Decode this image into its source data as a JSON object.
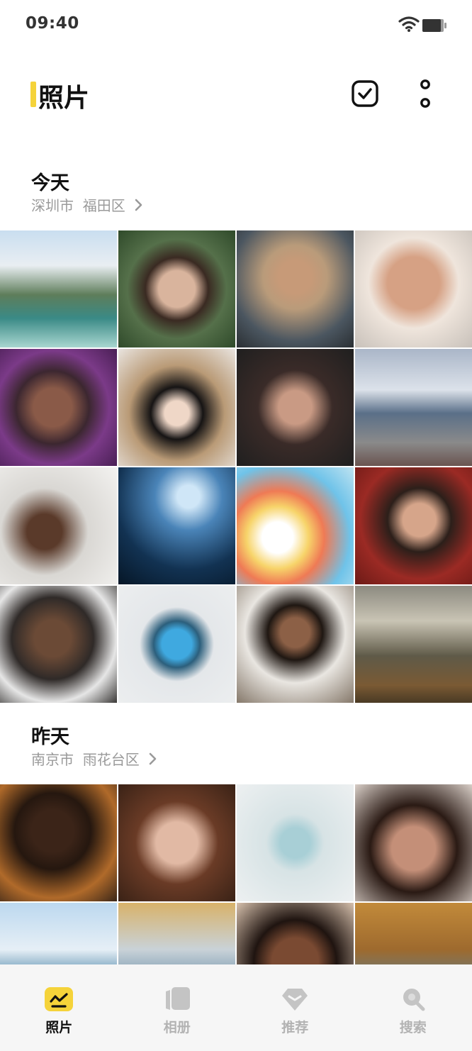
{
  "status_bar": {
    "time": "09:40"
  },
  "header": {
    "title": "照片"
  },
  "sections": [
    {
      "title": "今天",
      "location": "深圳市  福田区",
      "photos": [
        {
          "label": "mountain-lake",
          "bg": "linear-gradient(180deg,#c9def0 0%,#e9eef2 30%,#5e7d5a 55%,#3a8a86 75%,#a9d6d0 100%)"
        },
        {
          "label": "woman-flower",
          "bg": "radial-gradient(circle at 50% 50%,#d9b49d 0 22%,#3a2a22 38%,#55704a 60%,#2f4a2a 100%)"
        },
        {
          "label": "woman-curls",
          "bg": "radial-gradient(circle at 50% 40%,#c79a78 0 18%,#b99b7a 35%,#4b5660 70%,#2a2f33 100%)"
        },
        {
          "label": "girl-portrait",
          "bg": "radial-gradient(circle at 50% 45%,#d6a184 0 30%,#efe5dc 52%,#c8c1ba 100%)"
        },
        {
          "label": "woman-purple",
          "bg": "radial-gradient(circle at 45% 50%,#8a5a48 0 22%,#3c2730 42%,#7b3a88 65%,#4a1f55 100%)"
        },
        {
          "label": "woman-hat",
          "bg": "radial-gradient(circle at 50% 55%,#efd7c7 0 14%,#161414 30%,#b99a76 55%,#e9e4df 100%)"
        },
        {
          "label": "woman-dark",
          "bg": "radial-gradient(circle at 50% 50%,#c99a84 0 20%,#3a2b28 45%,#1f1f1f 100%)"
        },
        {
          "label": "mount-fuji",
          "bg": "linear-gradient(180deg,#aab6c8 0%,#dce2ea 35%,#5a6f88 55%,#8a8a8a 80%,#6a5450 100%)"
        },
        {
          "label": "woman-curtain",
          "bg": "radial-gradient(circle at 38% 55%,#5a3a2a 0 18%,#d9d7d3 45%,#f3f2f0 100%)"
        },
        {
          "label": "underwater-diver",
          "bg": "radial-gradient(circle at 60% 25%,#cfe6f7 0 10%,#4a84b8 30%,#123252 65%,#061626 100%)"
        },
        {
          "label": "phone-rainbow",
          "bg": "radial-gradient(circle at 35% 60%,#ffffff 0 15%,#f7d46a 30%,#ef7a55 45%,#6fc3e9 70%,#bfe3f1 100%)"
        },
        {
          "label": "woman-red",
          "bg": "radial-gradient(circle at 55% 45%,#d6a58a 0 18%,#2c1f1a 35%,#9b2a24 65%,#6c1a16 100%)"
        },
        {
          "label": "man-scarf",
          "bg": "radial-gradient(circle at 45% 45%,#6b4a36 0 20%,#2f2a28 45%,#e6e6e6 70%,#3a3836 100%)"
        },
        {
          "label": "phone-blue",
          "bg": "radial-gradient(circle at 50% 50%,#3fa9e0 0 18%,#2c5f7c 28%,#e4e7ea 45%,#eceeef 100%)"
        },
        {
          "label": "woman-white",
          "bg": "radial-gradient(circle at 50% 40%,#8c6046 0 16%,#1f1712 30%,#e9e6e1 55%,#85786a 100%)"
        },
        {
          "label": "forest-light",
          "bg": "linear-gradient(180deg,#8c8a80 0%,#c9c4b4 30%,#5f5a48 60%,#7a5a34 85%,#4a3a24 100%)"
        }
      ]
    },
    {
      "title": "昨天",
      "location": "南京市  雨花台区",
      "photos": [
        {
          "label": "man-turtleneck",
          "bg": "radial-gradient(circle at 45% 40%,#3b2418 0 22%,#25170f 40%,#b06a2a 70%,#3a2618 100%)"
        },
        {
          "label": "woman-curly",
          "bg": "radial-gradient(circle at 50% 50%,#e1b9a4 0 25%,#6a3b26 50%,#3a2216 100%)"
        },
        {
          "label": "phone-back",
          "bg": "radial-gradient(circle at 50% 50%,#a8cfd6 0 18%,#d7e3e5 35%,#edf0f1 100%)"
        },
        {
          "label": "woman-eyes-closed",
          "bg": "radial-gradient(circle at 50% 55%,#c48f78 0 25%,#2a1a14 50%,#d9cfc8 100%)"
        },
        {
          "label": "island-sea",
          "bg": "linear-gradient(180deg,#bcd8ef 0%,#e6eff6 40%,#6d9bb8 60%,#3b5f78 100%)"
        },
        {
          "label": "autumn-lake",
          "bg": "linear-gradient(180deg,#d8b26a 0%,#c9d2d8 40%,#8aa6b8 60%,#9a6a2a 100%)"
        },
        {
          "label": "woman-tan",
          "bg": "radial-gradient(circle at 50% 50%,#7a4a32 0 28%,#1f1410 50%,#d7c1ad 100%)"
        },
        {
          "label": "autumn-stream",
          "bg": "linear-gradient(180deg,#c28a3a 0%,#9e6a2e 40%,#6a7a7a 65%,#3a3228 100%)"
        }
      ]
    }
  ],
  "tabs": [
    {
      "label": "照片",
      "icon": "photo-icon",
      "active": true
    },
    {
      "label": "相册",
      "icon": "album-icon",
      "active": false
    },
    {
      "label": "推荐",
      "icon": "diamond-icon",
      "active": false
    },
    {
      "label": "搜索",
      "icon": "search-icon",
      "active": false
    }
  ],
  "colors": {
    "accent": "#f5d33a",
    "inactive": "#b3b3b3",
    "location": "#9a9a9a",
    "tab_bg": "#f6f6f6"
  }
}
